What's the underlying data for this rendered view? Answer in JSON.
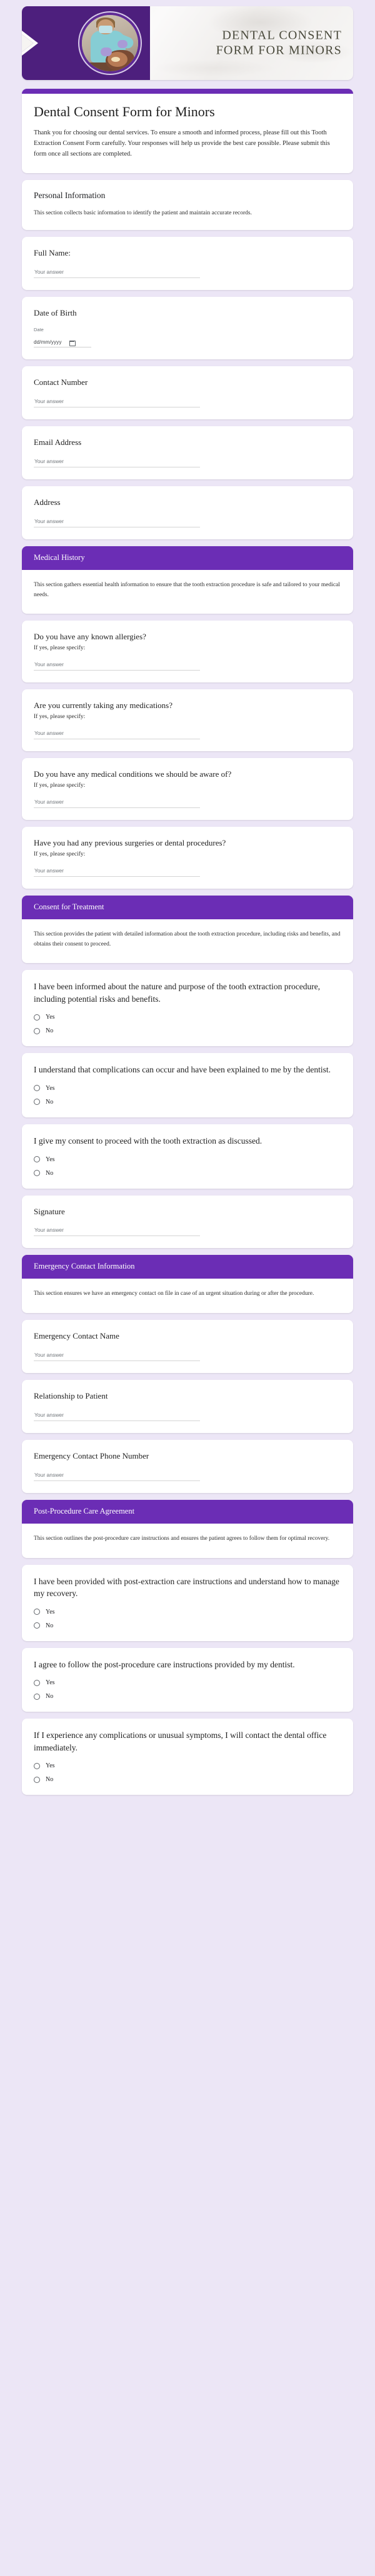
{
  "banner": {
    "title_line1": "DENTAL CONSENT",
    "title_line2": "FORM FOR MINORS",
    "photo_alt": "dentist-treating-patient-photo",
    "accent_color": "#4d1f7d"
  },
  "theme": {
    "accent": "#6b2db5",
    "page_background": "#ece6f6",
    "card_background": "#ffffff"
  },
  "intro": {
    "title": "Dental Consent Form for Minors",
    "description": "Thank you for choosing our dental services. To ensure a smooth and informed process, please fill out this Tooth Extraction Consent Form carefully. Your responses will help us provide the best care possible. Please submit this form once all sections are completed."
  },
  "common": {
    "answer_placeholder": "Your answer",
    "if_yes_specify": "If yes, please specify:",
    "date_caption": "Date",
    "date_format": "dd/mm/yyyy",
    "yes": "Yes",
    "no": "No"
  },
  "sections": [
    {
      "id": "personal-information",
      "header_style": "plain",
      "title": "Personal Information",
      "description": "This section collects basic information to identify the patient and maintain accurate records.",
      "questions": [
        {
          "id": "full-name",
          "type": "short-text",
          "label": "Full Name:"
        },
        {
          "id": "date-of-birth",
          "type": "date",
          "label": "Date of Birth"
        },
        {
          "id": "contact-number",
          "type": "short-text",
          "label": "Contact Number"
        },
        {
          "id": "email-address",
          "type": "short-text",
          "label": "Email Address"
        },
        {
          "id": "address",
          "type": "short-text",
          "label": "Address"
        }
      ]
    },
    {
      "id": "medical-history",
      "header_style": "purple",
      "title": "Medical History",
      "description": "This section gathers essential health information to ensure that the tooth extraction procedure is safe and tailored to your medical needs.",
      "questions": [
        {
          "id": "known-allergies",
          "type": "short-text-sub",
          "label": "Do you have any known allergies?",
          "sub": "If yes, please specify:"
        },
        {
          "id": "current-medications",
          "type": "short-text-sub",
          "label": "Are you currently taking any medications?",
          "sub": "If yes, please specify:"
        },
        {
          "id": "medical-conditions",
          "type": "short-text-sub",
          "label": "Do you have any medical conditions we should be aware of?",
          "sub": "If yes, please specify:"
        },
        {
          "id": "previous-surgeries",
          "type": "short-text-sub",
          "label": "Have you had any previous surgeries or dental procedures?",
          "sub": "If yes, please specify:"
        }
      ]
    },
    {
      "id": "consent-for-treatment",
      "header_style": "purple",
      "title": "Consent for Treatment",
      "description": "This section provides the patient with detailed information about the tooth extraction procedure, including risks and benefits, and obtains their consent to proceed.",
      "questions": [
        {
          "id": "informed-nature-purpose",
          "type": "yes-no",
          "label": "I have been informed about the nature and purpose of the tooth extraction procedure, including potential risks and benefits."
        },
        {
          "id": "understand-complications",
          "type": "yes-no",
          "label": "I understand that complications can occur and have been explained to me by the dentist."
        },
        {
          "id": "give-consent-proceed",
          "type": "yes-no",
          "label": "I give my consent to proceed with the tooth extraction as discussed."
        },
        {
          "id": "signature",
          "type": "short-text",
          "label": "Signature"
        }
      ]
    },
    {
      "id": "emergency-contact-information",
      "header_style": "purple",
      "title": "Emergency Contact Information",
      "description": "This section ensures we have an emergency contact on file in case of an urgent situation during or after the procedure.",
      "questions": [
        {
          "id": "emergency-contact-name",
          "type": "short-text",
          "label": "Emergency Contact Name"
        },
        {
          "id": "relationship-to-patient",
          "type": "short-text",
          "label": "Relationship to Patient"
        },
        {
          "id": "emergency-contact-phone-number",
          "type": "short-text",
          "label": "Emergency Contact Phone Number"
        }
      ]
    },
    {
      "id": "post-procedure-care-agreement",
      "header_style": "purple",
      "title": "Post-Procedure Care Agreement",
      "description": "This section outlines the post-procedure care instructions and ensures the patient agrees to follow them for optimal recovery.",
      "questions": [
        {
          "id": "provided-care-instructions",
          "type": "yes-no",
          "label": "I have been provided with post-extraction care instructions and understand how to manage my recovery."
        },
        {
          "id": "agree-follow-instructions",
          "type": "yes-no",
          "label": "I agree to follow the post-procedure care instructions provided by my dentist."
        },
        {
          "id": "contact-office-complications",
          "type": "yes-no",
          "label": "If I experience any complications or unusual symptoms, I will contact the dental office immediately."
        }
      ]
    }
  ]
}
